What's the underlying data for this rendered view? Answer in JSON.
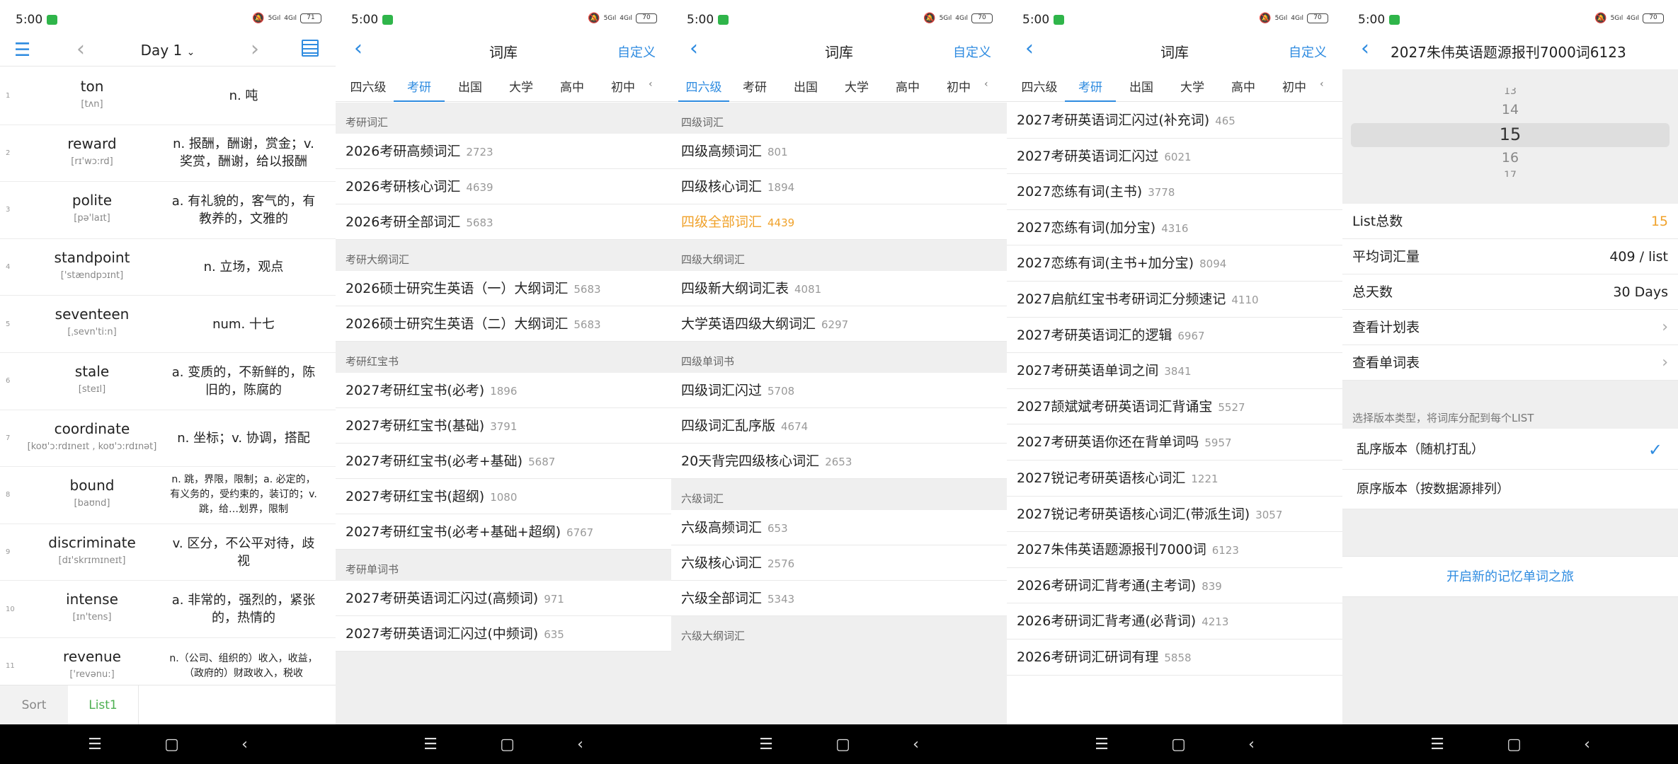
{
  "status": {
    "time": "5:00",
    "net_top": "5G",
    "net_bottom": "4G",
    "battery": [
      "71",
      "70",
      "70",
      "70",
      "70"
    ]
  },
  "system_nav": {
    "menu": "☰",
    "home": "▢",
    "back": "‹"
  },
  "screen1": {
    "day_label": "Day 1",
    "words": [
      {
        "n": "1",
        "en": "ton",
        "ph": "[tʌn]",
        "cn": "n. 吨"
      },
      {
        "n": "2",
        "en": "reward",
        "ph": "[rɪ'wɔ:rd]",
        "cn": "n. 报酬，酬谢，赏金；v. 奖赏，酬谢，给以报酬"
      },
      {
        "n": "3",
        "en": "polite",
        "ph": "[pə'laɪt]",
        "cn": "a. 有礼貌的，客气的，有教养的，文雅的"
      },
      {
        "n": "4",
        "en": "standpoint",
        "ph": "['stændpɔɪnt]",
        "cn": "n. 立场，观点"
      },
      {
        "n": "5",
        "en": "seventeen",
        "ph": "[ˌsevn'ti:n]",
        "cn": "num. 十七"
      },
      {
        "n": "6",
        "en": "stale",
        "ph": "[steɪl]",
        "cn": "a. 变质的，不新鲜的，陈旧的，陈腐的"
      },
      {
        "n": "7",
        "en": "coordinate",
        "ph": "[koʊ'ɔ:rdɪneɪt , koʊ'ɔ:rdɪnət]",
        "cn": "n. 坐标；v. 协调，搭配"
      },
      {
        "n": "8",
        "en": "bound",
        "ph": "[baʊnd]",
        "cn": "n. 跳，界限，限制；a. 必定的，有义务的，受约束的，装订的；v. 跳，给…划界，限制"
      },
      {
        "n": "9",
        "en": "discriminate",
        "ph": "[dɪ'skrɪmɪneɪt]",
        "cn": "v. 区分，不公平对待，歧视"
      },
      {
        "n": "10",
        "en": "intense",
        "ph": "[ɪn'tens]",
        "cn": "a. 非常的，强烈的，紧张的，热情的"
      },
      {
        "n": "11",
        "en": "revenue",
        "ph": "['revənu:]",
        "cn": "n.（公司、组织的）收入，收益，（政府的）财政收入，税收"
      }
    ],
    "tab_sort": "Sort",
    "tab_list": "List1"
  },
  "library": {
    "title": "词库",
    "back": "‹",
    "custom": "自定义",
    "tabs": [
      "四六级",
      "考研",
      "出国",
      "大学",
      "高中",
      "初中"
    ],
    "more": "‹"
  },
  "screen2": {
    "sections": [
      {
        "header": "考研词汇",
        "rows": [
          {
            "name": "2026考研高频词汇",
            "count": "2723"
          },
          {
            "name": "2026考研核心词汇",
            "count": "4639"
          },
          {
            "name": "2026考研全部词汇",
            "count": "5683"
          }
        ]
      },
      {
        "header": "考研大纲词汇",
        "rows": [
          {
            "name": "2026硕士研究生英语（一）大纲词汇",
            "count": "5683"
          },
          {
            "name": "2026硕士研究生英语（二）大纲词汇",
            "count": "5683"
          }
        ]
      },
      {
        "header": "考研红宝书",
        "rows": [
          {
            "name": "2027考研红宝书(必考)",
            "count": "1896"
          },
          {
            "name": "2027考研红宝书(基础)",
            "count": "3791"
          },
          {
            "name": "2027考研红宝书(必考+基础)",
            "count": "5687"
          },
          {
            "name": "2027考研红宝书(超纲)",
            "count": "1080"
          },
          {
            "name": "2027考研红宝书(必考+基础+超纲)",
            "count": "6767"
          }
        ]
      },
      {
        "header": "考研单词书",
        "rows": [
          {
            "name": "2027考研英语词汇闪过(高频词)",
            "count": "971"
          },
          {
            "name": "2027考研英语词汇闪过(中频词)",
            "count": "635"
          }
        ]
      }
    ]
  },
  "screen3": {
    "sections": [
      {
        "header": "四级词汇",
        "rows": [
          {
            "name": "四级高频词汇",
            "count": "801"
          },
          {
            "name": "四级核心词汇",
            "count": "1894"
          },
          {
            "name": "四级全部词汇",
            "count": "4439"
          }
        ]
      },
      {
        "header": "四级大纲词汇",
        "rows": [
          {
            "name": "四级新大纲词汇表",
            "count": "4081"
          },
          {
            "name": "大学英语四级大纲词汇",
            "count": "6297"
          }
        ]
      },
      {
        "header": "四级单词书",
        "rows": [
          {
            "name": "四级词汇闪过",
            "count": "5708"
          },
          {
            "name": "四级词汇乱序版",
            "count": "4674"
          },
          {
            "name": "20天背完四级核心词汇",
            "count": "2653"
          }
        ]
      },
      {
        "header": "六级词汇",
        "rows": [
          {
            "name": "六级高频词汇",
            "count": "653"
          },
          {
            "name": "六级核心词汇",
            "count": "2576"
          },
          {
            "name": "六级全部词汇",
            "count": "5343"
          }
        ]
      },
      {
        "header": "六级大纲词汇",
        "rows": []
      }
    ]
  },
  "screen4": {
    "rows": [
      {
        "name": "2027考研英语词汇闪过(补充词)",
        "count": "465"
      },
      {
        "name": "2027考研英语词汇闪过",
        "count": "6021"
      },
      {
        "name": "2027恋练有词(主书)",
        "count": "3778"
      },
      {
        "name": "2027恋练有词(加分宝)",
        "count": "4316"
      },
      {
        "name": "2027恋练有词(主书+加分宝)",
        "count": "8094"
      },
      {
        "name": "2027启航红宝书考研词汇分频速记",
        "count": "4110"
      },
      {
        "name": "2027考研英语词汇的逻辑",
        "count": "6967"
      },
      {
        "name": "2027考研英语单词之间",
        "count": "3841"
      },
      {
        "name": "2027颉斌斌考研英语词汇背诵宝",
        "count": "5527"
      },
      {
        "name": "2027考研英语你还在背单词吗",
        "count": "5957"
      },
      {
        "name": "2027锐记考研英语核心词汇",
        "count": "1221"
      },
      {
        "name": "2027锐记考研英语核心词汇(带派生词)",
        "count": "3057"
      },
      {
        "name": "2027朱伟英语题源报刊7000词",
        "count": "6123"
      },
      {
        "name": "2026考研词汇背考通(主考词)",
        "count": "839"
      },
      {
        "name": "2026考研词汇背考通(必背词)",
        "count": "4213"
      },
      {
        "name": "2026考研词汇研词有理",
        "count": "5858"
      }
    ]
  },
  "screen5": {
    "title": "2027朱伟英语题源报刊7000词6123",
    "picker": {
      "above2": "13",
      "above1": "14",
      "selected": "15",
      "below1": "16",
      "below2": "17"
    },
    "list_total_label": "List总数",
    "list_total_value": "15",
    "avg_label": "平均词汇量",
    "avg_value": "409 / list",
    "days_label": "总天数",
    "days_value": "30 Days",
    "plan_label": "查看计划表",
    "wordlist_label": "查看单词表",
    "chevron": "›",
    "hint": "选择版本类型，将词库分配到每个LIST",
    "option_random": "乱序版本（随机打乱）",
    "option_ordered": "原序版本（按数据源排列）",
    "check": "✓",
    "start_button": "开启新的记忆单词之旅"
  }
}
